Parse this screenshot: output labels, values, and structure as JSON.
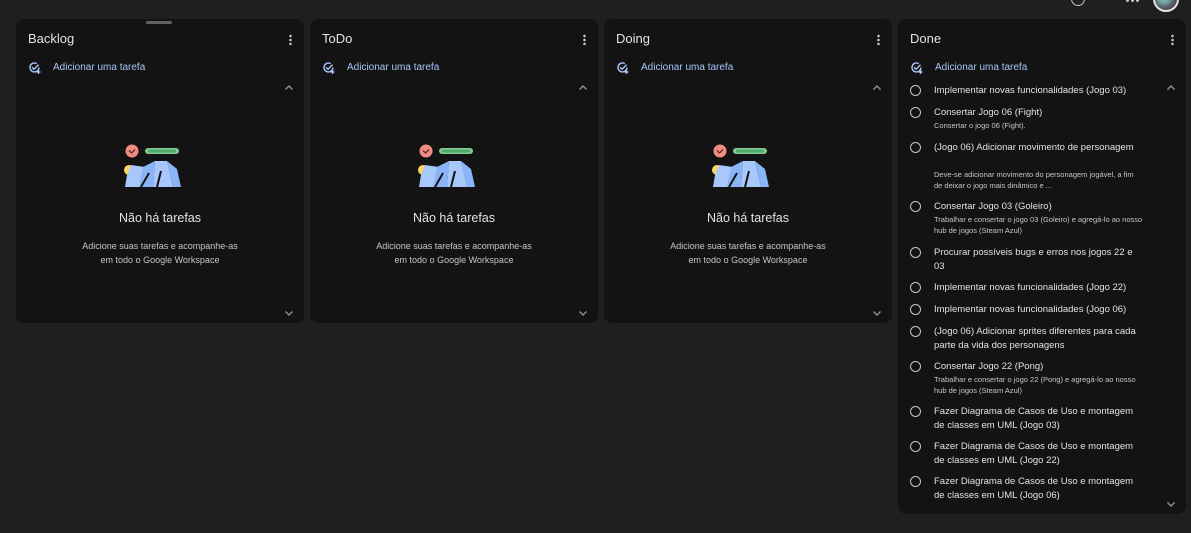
{
  "colors": {
    "background": "#1f1f1f",
    "column_bg": "#131314",
    "accent": "#a8c7fa"
  },
  "top_icons": [
    "help-icon",
    "apps-grid-icon",
    "avatar"
  ],
  "add_task_label": "Adicionar uma tarefa",
  "empty_state": {
    "title": "Não há tarefas",
    "description": "Adicione suas tarefas e acompanhe-as em todo o Google Workspace"
  },
  "columns": [
    {
      "title": "Backlog"
    },
    {
      "title": "ToDo"
    },
    {
      "title": "Doing"
    },
    {
      "title": "Done"
    }
  ],
  "done_tasks": [
    {
      "title": "Implementar novas funcionalidades (Jogo 03)",
      "notes": ""
    },
    {
      "title": "Consertar Jogo 06 (Fight)",
      "notes": "Consertar o jogo 06 (Fight)."
    },
    {
      "title": "(Jogo 06) Adicionar movimento de personagem",
      "notes": "Deve-se adicionar movimento do personagem jogável, a fim de deixar o jogo mais dinâmico e ..."
    },
    {
      "title": "Consertar Jogo 03 (Goleiro)",
      "notes": "Trabalhar e consertar o jogo 03 (Goleiro) e agregá-lo ao nosso hub de jogos (Steam Azul)"
    },
    {
      "title": "Procurar possíveis bugs e erros nos jogos 22 e 03",
      "notes": ""
    },
    {
      "title": "Implementar novas funcionalidades (Jogo 22)",
      "notes": ""
    },
    {
      "title": "Implementar novas funcionalidades (Jogo 06)",
      "notes": ""
    },
    {
      "title": "(Jogo 06) Adicionar sprites diferentes para cada parte da vida dos personagens",
      "notes": ""
    },
    {
      "title": "Consertar Jogo 22 (Pong)",
      "notes": "Trabalhar e consertar o jogo 22 (Pong) e agregá-lo ao nosso hub de jogos (Steam Azul)"
    },
    {
      "title": "Fazer Diagrama de Casos de Uso e montagem de classes em UML (Jogo 03)",
      "notes": ""
    },
    {
      "title": "Fazer Diagrama de Casos de Uso e montagem de classes em UML (Jogo 22)",
      "notes": ""
    },
    {
      "title": "Fazer Diagrama de Casos de Uso e montagem de classes em UML (Jogo 06)",
      "notes": ""
    }
  ]
}
